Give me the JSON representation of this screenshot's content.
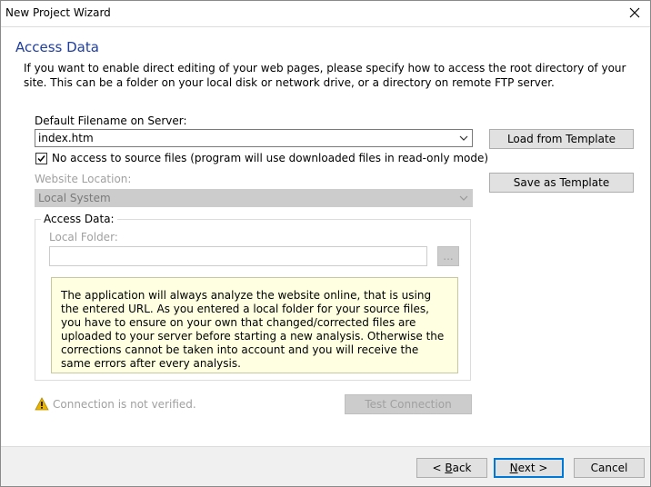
{
  "window": {
    "title": "New Project Wizard"
  },
  "page": {
    "heading": "Access Data",
    "description": "If you want to enable direct editing of your web pages, please specify how to access the root directory of your site. This can be a folder on your local disk or network drive, or a directory on remote FTP server."
  },
  "form": {
    "default_filename_label": "Default Filename on Server:",
    "default_filename_value": "index.htm",
    "no_access_checkbox_label": "No access to source files (program will use downloaded files in read-only mode)",
    "no_access_checked": true,
    "website_location_label": "Website Location:",
    "website_location_value": "Local System",
    "access_group_label": "Access Data:",
    "local_folder_label": "Local Folder:",
    "local_folder_value": "",
    "browse_label": "...",
    "note": "The application will always analyze the website online, that is using the entered URL. As you entered a local folder for your source files, you have to ensure on your own that changed/corrected files are uploaded to your server before starting a new analysis. Otherwise the corrections cannot be taken into account and you will receive the same errors after every analysis.",
    "connection_status": "Connection is not verified.",
    "test_connection_label": "Test Connection"
  },
  "side_buttons": {
    "load_template": "Load from Template",
    "save_template": "Save as Template"
  },
  "footer": {
    "back_prefix": "< ",
    "back_mnemonic": "B",
    "back_rest": "ack",
    "next_mnemonic": "N",
    "next_rest": "ext >",
    "cancel": "Cancel"
  },
  "colors": {
    "heading": "#1f3e9e",
    "accent": "#0078d7",
    "note_bg": "#ffffe1",
    "warning": "#e8b400"
  },
  "icons": [
    "close-icon",
    "chevron-down-icon",
    "checkmark-icon",
    "warning-icon"
  ]
}
